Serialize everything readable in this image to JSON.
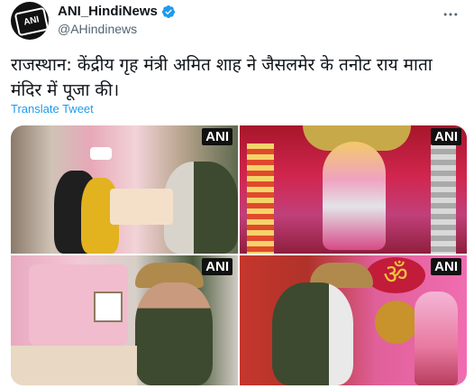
{
  "account": {
    "name": "ANI_HindiNews",
    "handle": "@AHindinews",
    "avatar_text": "ANI",
    "verified_color": "#1d9bf0"
  },
  "tweet": {
    "text": "राजस्थान: केंद्रीय गृह मंत्री अमित शाह ने जैसलमेर के तनोट राय माता मंदिर में पूजा की।",
    "translate_label": "Translate Tweet"
  },
  "media": {
    "watermarks": [
      "ANI",
      "ANI",
      "ANI",
      "ANI"
    ]
  },
  "icons": {
    "more": "more-options-icon",
    "verified": "verified-badge-icon"
  }
}
